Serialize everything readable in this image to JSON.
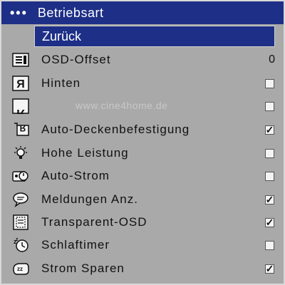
{
  "window": {
    "dots": "•••",
    "title": "Betriebsart"
  },
  "back_label": "Zurück",
  "watermark": "www.cine4home.de",
  "items": [
    {
      "label": "OSD-Offset",
      "value": "0",
      "icon": "osd-offset-icon"
    },
    {
      "label": "Hinten",
      "checked": false,
      "icon": "rear-projection-icon"
    },
    {
      "label": "",
      "checked": false,
      "icon": "mirrored-projection-icon"
    },
    {
      "label": "Auto-Deckenbefestigung",
      "checked": true,
      "icon": "ceiling-mount-icon"
    },
    {
      "label": "Hohe Leistung",
      "checked": false,
      "icon": "lightbulb-icon"
    },
    {
      "label": "Auto-Strom",
      "checked": false,
      "icon": "auto-power-icon"
    },
    {
      "label": "Meldungen Anz.",
      "checked": true,
      "icon": "message-bubble-icon"
    },
    {
      "label": "Transparent-OSD",
      "checked": true,
      "icon": "transparent-osd-icon"
    },
    {
      "label": "Schlaftimer",
      "checked": false,
      "icon": "sleep-timer-icon"
    },
    {
      "label": "Strom Sparen",
      "checked": true,
      "icon": "power-save-icon"
    }
  ],
  "colors": {
    "header": "#1d2f86",
    "panel": "#a9a9a9",
    "checkbox": "#f3f3f3"
  },
  "check_glyph": "✓"
}
